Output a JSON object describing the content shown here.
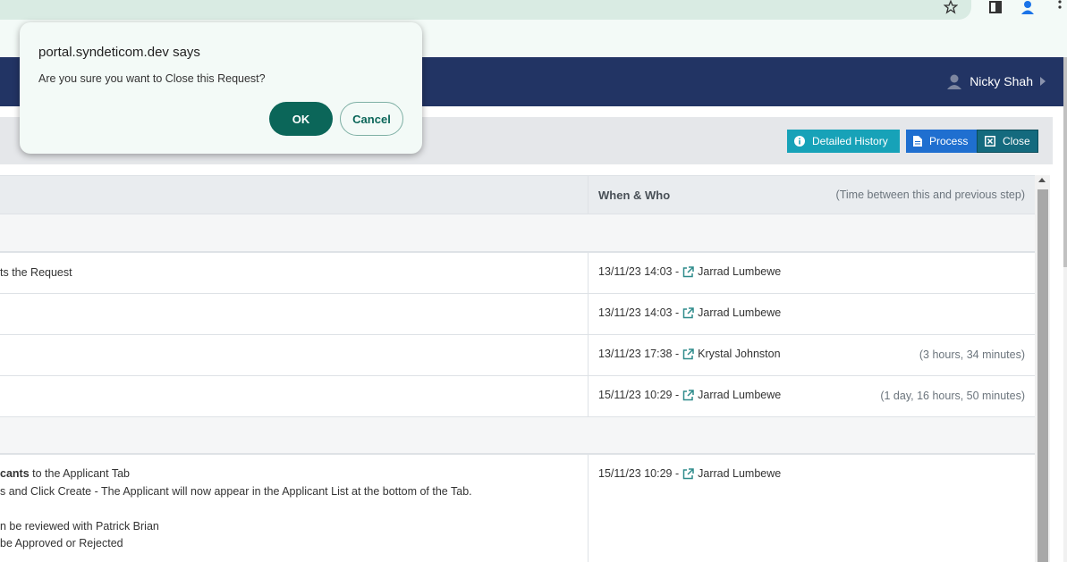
{
  "dialog": {
    "title": "portal.syndeticom.dev says",
    "message": "Are you sure you want to Close this Request?",
    "ok_label": "OK",
    "cancel_label": "Cancel"
  },
  "navbar": {
    "user_name": "Nicky Shah"
  },
  "toolbar": {
    "history_label": "Detailed History",
    "process_label": "Process",
    "close_label": "Close"
  },
  "table": {
    "header_when": "When & Who",
    "header_time": "(Time between this and previous step)",
    "rows": [
      {
        "left": "ts the Request",
        "when": "13/11/23 14:03 -",
        "who": "Jarrad Lumbewe",
        "duration": ""
      },
      {
        "left": "",
        "when": "13/11/23 14:03 -",
        "who": "Jarrad Lumbewe",
        "duration": ""
      },
      {
        "left": "",
        "when": "13/11/23 17:38 -",
        "who": "Krystal Johnston",
        "duration": "(3 hours, 34 minutes)"
      },
      {
        "left": "",
        "when": "15/11/23 10:29 -",
        "who": "Jarrad Lumbewe",
        "duration": "(1 day, 16 hours, 50 minutes)"
      }
    ],
    "big_row": {
      "line1_bold": "cants",
      "line1_rest": " to the Applicant Tab",
      "line2": "s and Click Create - The Applicant will now appear in the Applicant List at the bottom of the Tab.",
      "line3": "n be reviewed with Patrick Brian",
      "line4": " be Approved or Rejected",
      "when": "15/11/23 10:29 -",
      "who": "Jarrad Lumbewe"
    }
  },
  "colors": {
    "navbar": "#223464",
    "ok_button": "#0b6659",
    "history_button": "#17a2b8",
    "process_button": "#1f6fd0",
    "close_button": "#146a7e"
  }
}
